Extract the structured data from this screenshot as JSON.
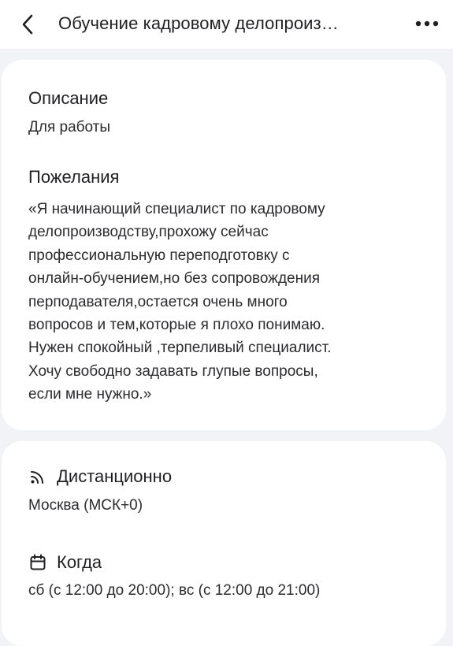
{
  "header": {
    "title": "Обучение кадровому делопроиз…",
    "back_icon": "chevron-left-icon",
    "more_icon": "more-horizontal-icon"
  },
  "description": {
    "title": "Описание",
    "text": "Для работы"
  },
  "wishes": {
    "title": "Пожелания",
    "lines": [
      "«Я начинающий специалист по кадровому",
      "делопроизводству,прохожу сейчас",
      "профессиональную переподготовку с",
      "онлайн-обучением,но без сопровождения",
      "перподавателя,остается очень много",
      "вопросов и тем,которые я плохо понимаю.",
      "Нужен спокойный ,терпеливый специалист.",
      "Хочу свободно задавать глупые вопросы,",
      "если мне нужно.»"
    ]
  },
  "format": {
    "icon": "broadcast-icon",
    "title": "Дистанционно",
    "text": "Москва (МСК+0)"
  },
  "schedule": {
    "icon": "calendar-icon",
    "title": "Когда",
    "text": "сб (с 12:00 до 20:00); вс (с 12:00 до 21:00)"
  },
  "colors": {
    "background": "#f2f3f7",
    "card": "#ffffff",
    "text": "#1f1f24"
  }
}
